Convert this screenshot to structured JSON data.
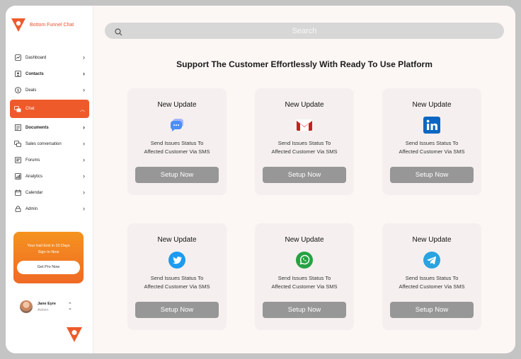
{
  "brand": {
    "name": "Bottom Funnel Chat"
  },
  "sidebar": {
    "items": [
      {
        "label": "Dashboard",
        "icon": "chart-icon"
      },
      {
        "label": "Contacts",
        "icon": "contacts-icon"
      },
      {
        "label": "Deals",
        "icon": "dollar-icon"
      },
      {
        "label": "Chat",
        "icon": "chat-icon"
      },
      {
        "label": "Documents",
        "icon": "document-icon"
      },
      {
        "label": "Sales conversation",
        "icon": "conversation-icon"
      },
      {
        "label": "Forums",
        "icon": "forum-icon"
      },
      {
        "label": "Analytics",
        "icon": "analytics-icon"
      },
      {
        "label": "Calendar",
        "icon": "calendar-icon"
      },
      {
        "label": "Admin",
        "icon": "admin-icon"
      }
    ]
  },
  "promo": {
    "line1": "Your trail End in 10 Days",
    "line2": "Sign In Now",
    "button": "Get Pro Now"
  },
  "user": {
    "name": "Jane Eyre",
    "role": "Admin"
  },
  "search": {
    "placeholder": "Search"
  },
  "headline": "Support The Customer Effortlessly With Ready To Use Platform",
  "cards": [
    {
      "title": "New Update",
      "line1": "Send Issues Status To",
      "line2": "Affected Customer Via SMS",
      "button": "Setup Now",
      "icon": "messenger-icon"
    },
    {
      "title": "New Update",
      "line1": "Send Issues Status To",
      "line2": "Affected Customer Via SMS",
      "button": "Setup Now",
      "icon": "gmail-icon"
    },
    {
      "title": "New Update",
      "line1": "Send Issues Status To",
      "line2": "Affected Customer Via SMS",
      "button": "Setup Now",
      "icon": "linkedin-icon"
    },
    {
      "title": "New Update",
      "line1": "Send Issues Status To",
      "line2": "Affected Customer Via SMS",
      "button": "Setup Now",
      "icon": "twitter-icon"
    },
    {
      "title": "New Update",
      "line1": "Send Issues Status To",
      "line2": "Affected Customer Via SMS",
      "button": "Setup Now",
      "icon": "whatsapp-icon"
    },
    {
      "title": "New Update",
      "line1": "Send Issues Status To",
      "line2": "Affected Customer Via SMS",
      "button": "Setup Now",
      "icon": "telegram-icon"
    }
  ],
  "colors": {
    "accent": "#ef5a2a",
    "button": "#979797",
    "background": "#fcf7f5"
  }
}
